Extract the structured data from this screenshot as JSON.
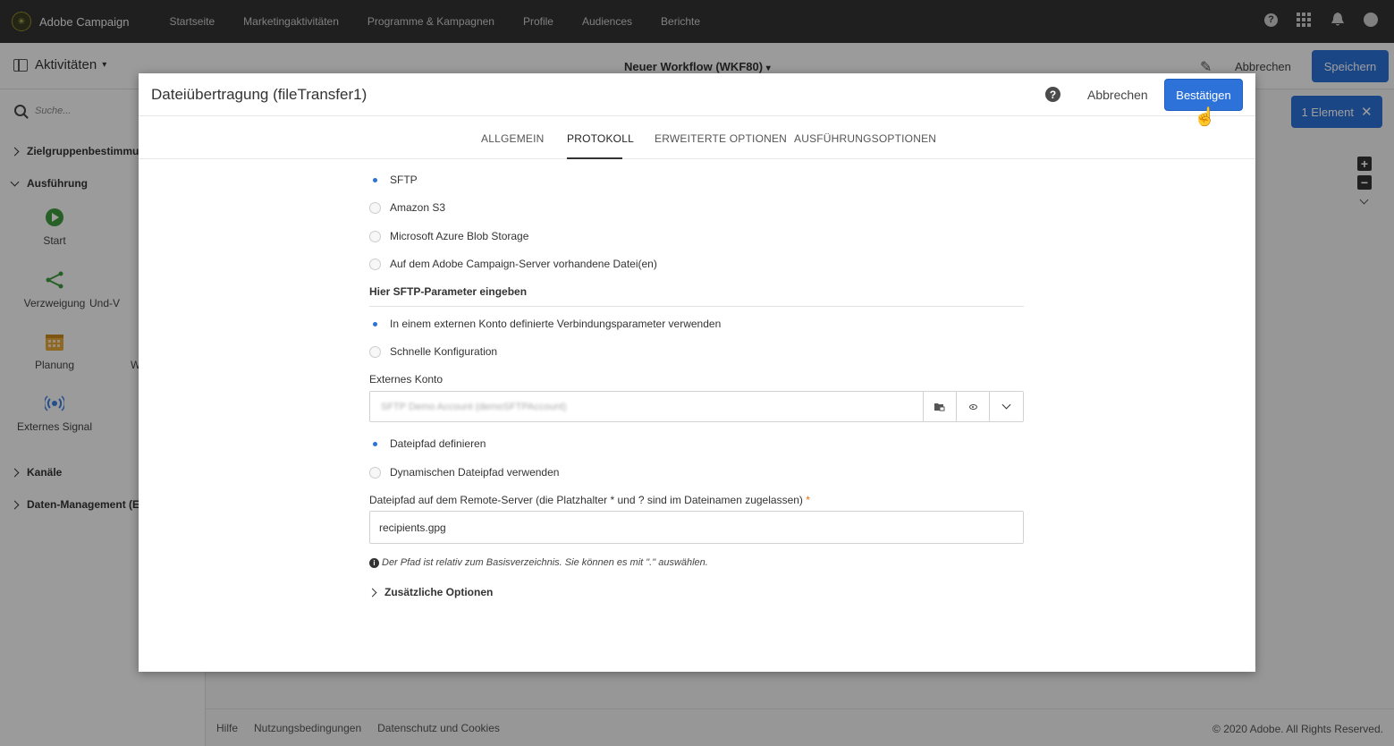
{
  "app": {
    "name": "Adobe Campaign",
    "nav": [
      "Startseite",
      "Marketingaktivitäten",
      "Programme & Kampagnen",
      "Profile",
      "Audiences",
      "Berichte"
    ]
  },
  "toolbar": {
    "activities_label": "Aktivitäten",
    "workflow_title": "Neuer Workflow (WKF80)",
    "cancel_label": "Abbrechen",
    "save_label": "Speichern",
    "selection_label": "1 Element"
  },
  "sidebar": {
    "search_placeholder": "Suche...",
    "categories": {
      "targeting": "Zielgruppenbestimmung",
      "execution": "Ausführung",
      "channels": "Kanäle",
      "data_management": "Daten-Management (ETL)"
    },
    "activities": [
      "Start",
      "Verzweigung",
      "Und-V",
      "Planung",
      "W",
      "Externes Signal"
    ]
  },
  "footer": {
    "links": [
      "Hilfe",
      "Nutzungsbedingungen",
      "Datenschutz und Cookies"
    ],
    "copyright": "© 2020 Adobe. All Rights Reserved."
  },
  "modal": {
    "title": "Dateiübertragung (fileTransfer1)",
    "cancel_label": "Abbrechen",
    "confirm_label": "Bestätigen",
    "tabs": [
      "ALLGEMEIN",
      "PROTOKOLL",
      "ERWEITERTE OPTIONEN",
      "AUSFÜHRUNGSOPTIONEN"
    ],
    "active_tab": "PROTOKOLL",
    "protocol_options": [
      {
        "label": "SFTP",
        "selected": true
      },
      {
        "label": "Amazon S3",
        "selected": false
      },
      {
        "label": "Microsoft Azure Blob Storage",
        "selected": false
      },
      {
        "label": "Auf dem Adobe Campaign-Server vorhandene Datei(en)",
        "selected": false
      }
    ],
    "sftp_section_label": "Hier SFTP-Parameter eingeben",
    "connection_options": [
      {
        "label": "In einem externen Konto definierte Verbindungsparameter verwenden",
        "selected": true
      },
      {
        "label": "Schnelle Konfiguration",
        "selected": false
      }
    ],
    "external_account_label": "Externes Konto",
    "external_account_value": "SFTP Demo Account (demoSFTPAccount)",
    "path_options": [
      {
        "label": "Dateipfad definieren",
        "selected": true
      },
      {
        "label": "Dynamischen Dateipfad verwenden",
        "selected": false
      }
    ],
    "remote_path_label": "Dateipfad auf dem Remote-Server (die Platzhalter * und ? sind im Dateinamen zugelassen)",
    "required_marker": "*",
    "remote_path_value": "recipients.gpg",
    "hint": "Der Pfad ist relativ zum Basisverzeichnis. Sie können es mit \".\" auswählen.",
    "additional_options_label": "Zusätzliche Optionen"
  },
  "colors": {
    "accent": "#2c72d9",
    "topbar": "#323232",
    "required": "#e2720d"
  }
}
